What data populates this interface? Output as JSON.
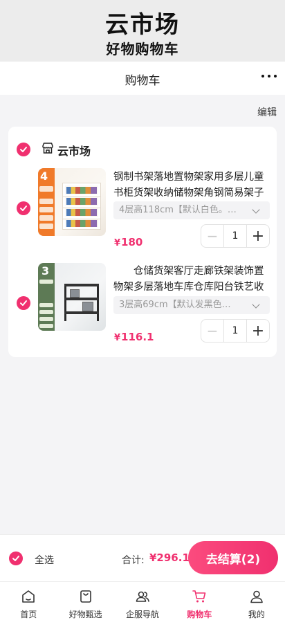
{
  "banner": {
    "title": "云市场",
    "subtitle": "好物购物车"
  },
  "navbar": {
    "title": "购物车",
    "more_icon": "more-dots-icon"
  },
  "edit_label": "编辑",
  "store": {
    "name": "云市场",
    "icon": "store-icon"
  },
  "items": [
    {
      "badge": "4",
      "title": "钢制书架落地置物架家用多层儿童书柜货架收纳储物架角钢简易架子",
      "spec": "4层高118cm【默认白色。…",
      "currency": "¥",
      "price": "180",
      "quantity": "1"
    },
    {
      "badge": "3",
      "title": "　　仓储货架客厅走廊铁架装饰置物架多层落地车库仓库阳台铁艺收",
      "spec": "3层高69cm【默认发黑色…",
      "currency": "¥",
      "price": "116.1",
      "quantity": "1"
    }
  ],
  "stepper": {
    "minus": "−",
    "plus": "+"
  },
  "checkout": {
    "select_all": "全选",
    "total_label": "合计:",
    "total": "¥296.1",
    "pay_button": "去结算(2)"
  },
  "tabs": [
    {
      "label": "首页",
      "icon": "home-icon"
    },
    {
      "label": "好物甄选",
      "icon": "bag-icon"
    },
    {
      "label": "企服导航",
      "icon": "users-icon"
    },
    {
      "label": "购物车",
      "icon": "cart-icon",
      "active": true
    },
    {
      "label": "我的",
      "icon": "user-icon"
    }
  ],
  "colors": {
    "accent": "#f0306f",
    "background": "#f4f4f6"
  }
}
